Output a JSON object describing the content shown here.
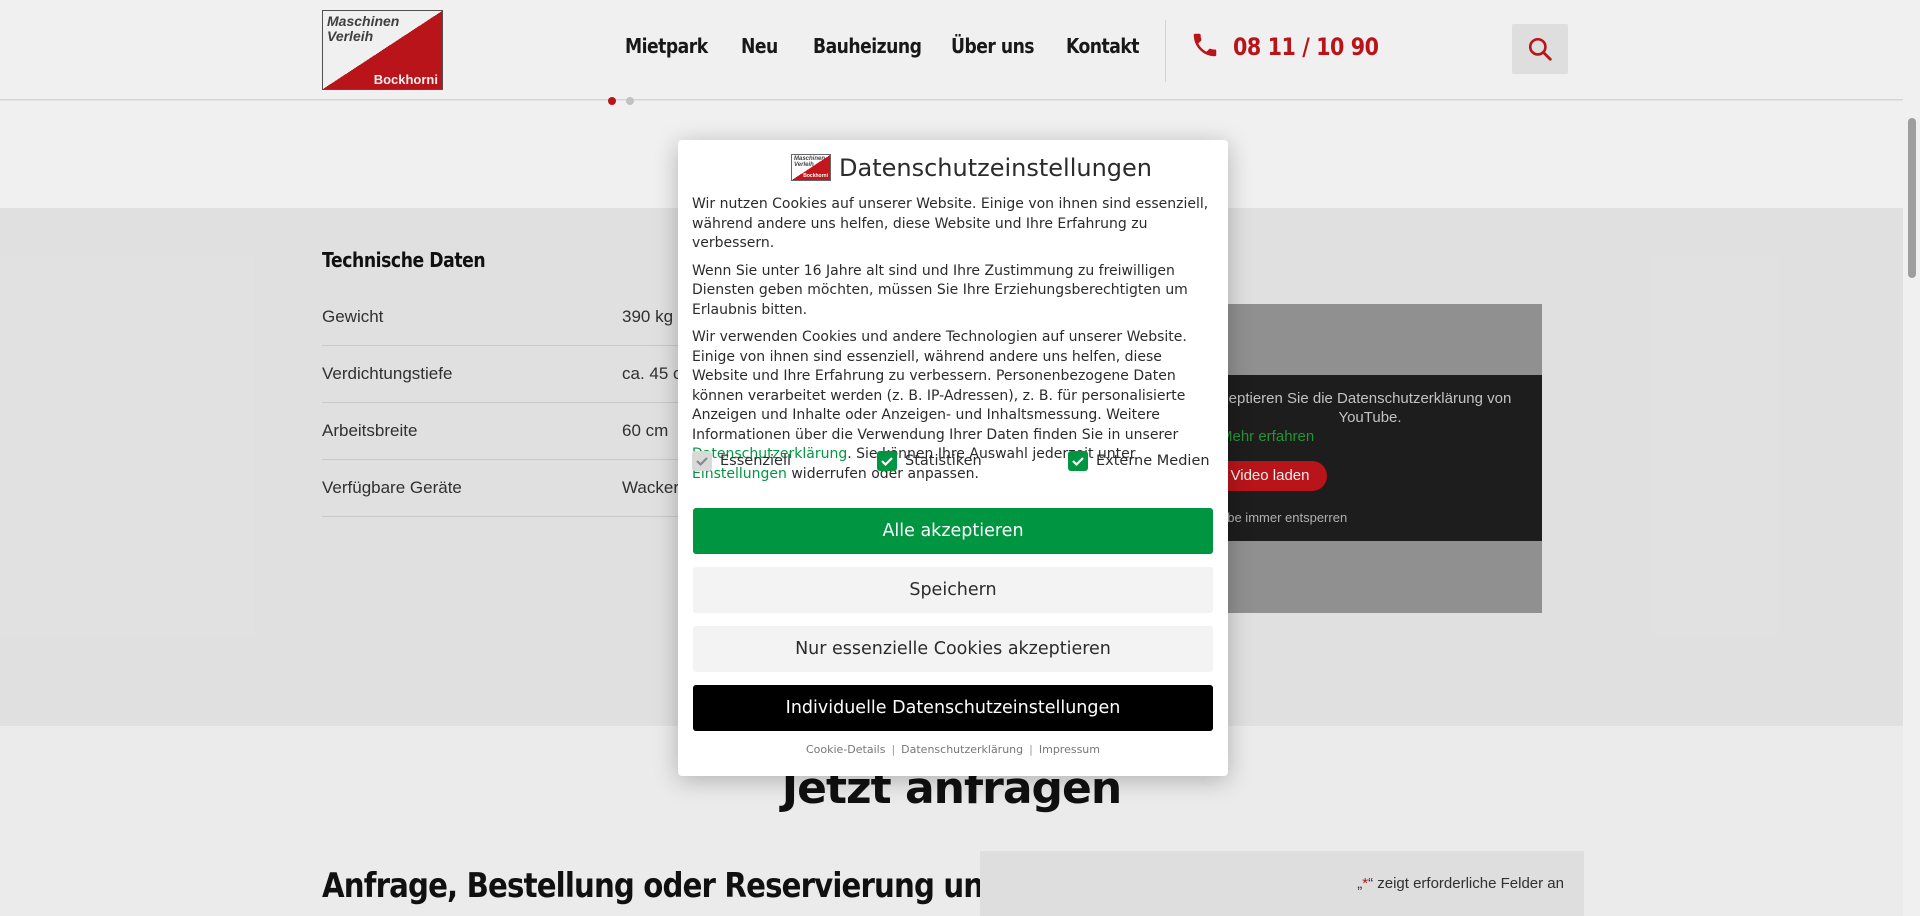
{
  "header": {
    "logo": {
      "line1": "Maschinen",
      "line2": "Verleih",
      "line3": "Bockhorni"
    },
    "nav": [
      "Mietpark",
      "Neu",
      "Bauheizung",
      "Über uns",
      "Kontakt"
    ],
    "phone": "08 11 / 10 90",
    "icons": {
      "phone": "phone-icon",
      "search": "search-icon"
    }
  },
  "tech": {
    "title": "Technische Daten",
    "rows": [
      {
        "key": "Gewicht",
        "value": "390 kg"
      },
      {
        "key": "Verdichtungstiefe",
        "value": "ca. 45 c"
      },
      {
        "key": "Arbeitsbreite",
        "value": "60 cm"
      },
      {
        "key": "Verfügbare Geräte",
        "value": "Wacker"
      }
    ]
  },
  "video": {
    "text": "eptieren Sie die Datenschutzerklärung von YouTube.",
    "more": "Mehr erfahren",
    "load_button": "Video laden",
    "unlock": "ube immer entsperren"
  },
  "section": {
    "heading": "Jetzt anfragen",
    "subheading": "Anfrage, Bestellung oder Reservierung unter",
    "required_note_prefix": "„",
    "required_note_star": "*",
    "required_note_suffix": "“ zeigt erforderliche Felder an"
  },
  "consent": {
    "logo": {
      "line1": "Maschinen",
      "line2": "Verleih",
      "line3": "Bockhorni"
    },
    "title": "Datenschutzeinstellungen",
    "p1": "Wir nutzen Cookies auf unserer Website. Einige von ihnen sind essenziell, während andere uns helfen, diese Website und Ihre Erfahrung zu verbessern.",
    "p2": "Wenn Sie unter 16 Jahre alt sind und Ihre Zustimmung zu freiwilligen Diensten geben möchten, müssen Sie Ihre Erziehungsberechtigten um Erlaubnis bitten.",
    "p3_before": "Wir verwenden Cookies und andere Technologien auf unserer Website. Einige von ihnen sind essenziell, während andere uns helfen, diese Website und Ihre Erfahrung zu verbessern. Personenbezogene Daten können verarbeitet werden (z. B. IP-Adressen), z. B. für personalisierte Anzeigen und Inhalte oder Anzeigen- und Inhaltsmessung. Weitere Informationen über die Verwendung Ihrer Daten finden Sie in unserer ",
    "p3_link1": "Datenschutzerklärung",
    "p3_middle": ". Sie können Ihre Auswahl jederzeit unter ",
    "p3_link2": "Einstellungen",
    "p3_after": " widerrufen oder anpassen.",
    "checkboxes": [
      {
        "label": "Essenziell",
        "checked": true,
        "disabled": true
      },
      {
        "label": "Statistiken",
        "checked": true,
        "disabled": false
      },
      {
        "label": "Externe Medien",
        "checked": true,
        "disabled": false
      }
    ],
    "buttons": {
      "accept_all": "Alle akzeptieren",
      "save": "Speichern",
      "essential_only": "Nur essenzielle Cookies akzeptieren",
      "individual": "Individuelle Datenschutzeinstellungen"
    },
    "footer_links": [
      "Cookie-Details",
      "Datenschutzerklärung",
      "Impressum"
    ],
    "colors": {
      "accent": "#009540",
      "brand": "#c4161c"
    }
  }
}
